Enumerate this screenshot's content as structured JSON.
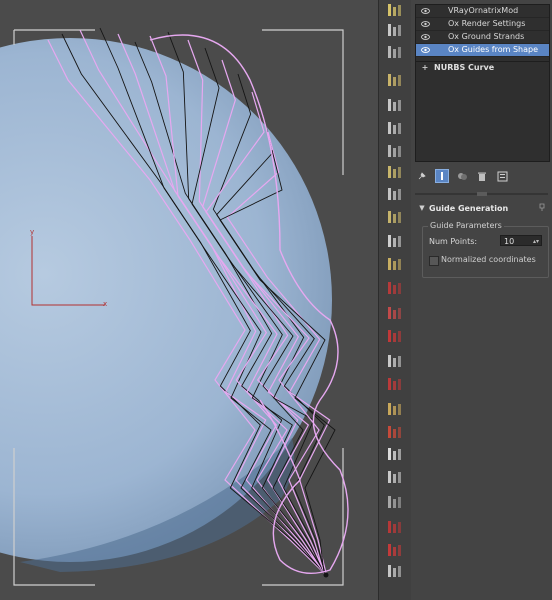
{
  "modifier_stack": {
    "items": [
      {
        "label": "VRayOrnatrixMod",
        "selected": false
      },
      {
        "label": "Ox Render Settings",
        "selected": false
      },
      {
        "label": "Ox Ground Strands",
        "selected": false
      },
      {
        "label": "Ox Guides from Shape",
        "selected": true
      }
    ],
    "base_object": "NURBS Curve"
  },
  "rollout": {
    "title": "Guide Generation",
    "group_title": "Guide Parameters",
    "num_points_label": "Num Points:",
    "num_points_value": "10",
    "normalized_label": "Normalized coordinates",
    "normalized_checked": false
  },
  "colors": {
    "selection": "#5a85c4",
    "sphere": "#9fb8d4",
    "guide_pink": "#e6a8f0",
    "guide_black": "#151515",
    "axis_red": "#b23030"
  },
  "icons": {
    "stack_tools": [
      "pin-stack-icon",
      "show-end-result-icon",
      "make-unique-icon",
      "remove-modifier-icon",
      "configure-modifier-sets-icon"
    ]
  }
}
